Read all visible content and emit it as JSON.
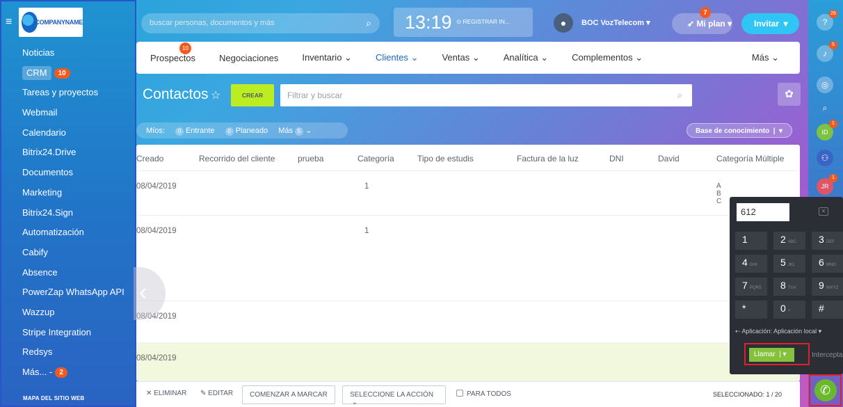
{
  "app": {
    "company_name": "COMPANYNAME"
  },
  "sidebar": {
    "items": [
      {
        "label": "Noticias"
      },
      {
        "label": "CRM",
        "badge": "10"
      },
      {
        "label": "Tareas y proyectos"
      },
      {
        "label": "Webmail"
      },
      {
        "label": "Calendario"
      },
      {
        "label": "Bitrix24.Drive"
      },
      {
        "label": "Documentos"
      },
      {
        "label": "Marketing"
      },
      {
        "label": "Bitrix24.Sign"
      },
      {
        "label": "Automatización"
      },
      {
        "label": "Cabify"
      },
      {
        "label": "Absence"
      },
      {
        "label": "PowerZap WhatsApp API"
      },
      {
        "label": "Wazzup"
      },
      {
        "label": "Stripe Integration"
      },
      {
        "label": "Redsys"
      },
      {
        "label": "Más... -",
        "badge": "2"
      }
    ],
    "footer": "MAPA DEL SITIO WEB"
  },
  "header": {
    "search_placeholder": "buscar personas, documentos y más",
    "clock": "13:19",
    "register": "REGISTRAR IN...",
    "user_name": "BOC VozTelecom",
    "plan_label": "Mi plan",
    "plan_badge": "7",
    "invite_label": "Invitar"
  },
  "nav": {
    "tabs": [
      {
        "label": "Prospectos",
        "badge": "10"
      },
      {
        "label": "Negociaciones"
      },
      {
        "label": "Inventario"
      },
      {
        "label": "Clientes",
        "active": true
      },
      {
        "label": "Ventas"
      },
      {
        "label": "Analítica"
      },
      {
        "label": "Complementos"
      }
    ],
    "more": "Más"
  },
  "page": {
    "title": "Contactos",
    "create_label": "CREAR",
    "filter_placeholder": "Filtrar y buscar"
  },
  "counters": {
    "mine": "Míos:",
    "entrante_count": "0",
    "entrante": "Entrante",
    "planeado_count": "0",
    "planeado": "Planeado",
    "mas": "Más",
    "mas_count": "5",
    "knowledge_base": "Base de conocimiento"
  },
  "grid": {
    "columns": [
      "Creado",
      "Recorrido del cliente",
      "prueba",
      "Categoría",
      "Tipo de estudis",
      "Factura de la luz",
      "DNI",
      "David",
      "Categoría Múltiple"
    ],
    "rows": [
      {
        "created": "08/04/2019",
        "category": "1",
        "multi": [
          "A",
          "B",
          "C"
        ]
      },
      {
        "created": "08/04/2019",
        "category": "1",
        "multi": []
      },
      {
        "created": "08/04/2019",
        "category": "",
        "multi": []
      },
      {
        "created": "08/04/2019",
        "category": "",
        "multi": [],
        "selected": true
      }
    ]
  },
  "actions": {
    "delete": "ELIMINAR",
    "edit": "EDITAR",
    "start_dial": "COMENZAR A MARCAR",
    "select_action": "SELECCIONE LA ACCIÓN",
    "for_all": "PARA TODOS",
    "selected": "SELECCIONADO: 1 / 20"
  },
  "rail": {
    "help_badge": "26",
    "notif_badge": "5",
    "id_label": "ID",
    "id_badge": "1",
    "jr_label": "JR",
    "jr_badge": "1"
  },
  "dialer": {
    "number": "612",
    "keys": [
      {
        "d": "1",
        "s": ""
      },
      {
        "d": "2",
        "s": "ABC"
      },
      {
        "d": "3",
        "s": "DEF"
      },
      {
        "d": "4",
        "s": "GHI"
      },
      {
        "d": "5",
        "s": "JKL"
      },
      {
        "d": "6",
        "s": "MNO"
      },
      {
        "d": "7",
        "s": "PQRS"
      },
      {
        "d": "8",
        "s": "TUV"
      },
      {
        "d": "9",
        "s": "WXYZ"
      },
      {
        "d": "*",
        "s": ""
      },
      {
        "d": "0",
        "s": "+"
      },
      {
        "d": "#",
        "s": ""
      }
    ],
    "app_label": "Aplicación: Aplicación local",
    "call_label": "Llamar",
    "intercept_label": "Interceptar"
  },
  "colors": {
    "accent": "#2fc6f6",
    "create": "#bbed21",
    "badge": "#f35b1e",
    "call": "#86c13d",
    "highlight_border": "#e0212b"
  }
}
